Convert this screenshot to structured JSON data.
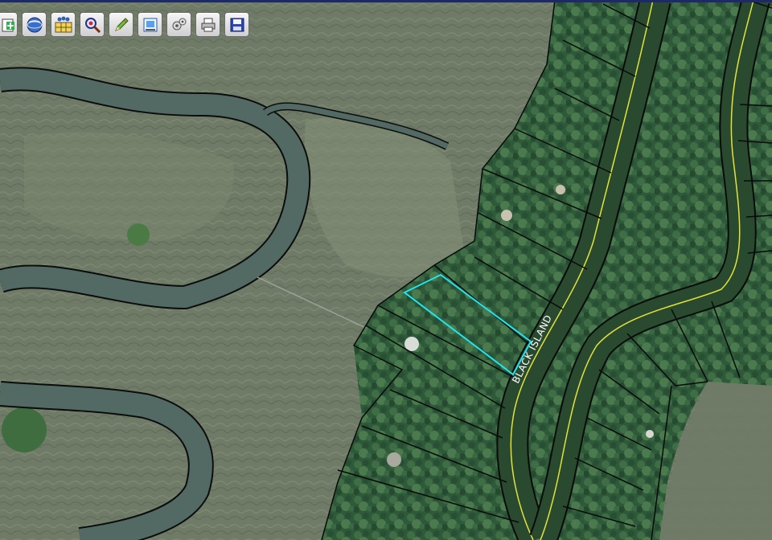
{
  "map": {
    "street_label": "BLACK ISLAND",
    "colors": {
      "marsh": "#6f7b67",
      "marsh_light": "#838f76",
      "water": "#536a64",
      "forest": "#2f5a3a",
      "forest_light": "#4c7a4e",
      "parcel_line": "#0a0a0a",
      "road_centerline": "#e2e23a",
      "selected_parcel": "#22e4f0",
      "window_border": "#1e2a66"
    }
  },
  "toolbar": {
    "buttons": [
      {
        "name": "add-icon"
      },
      {
        "name": "globe-icon"
      },
      {
        "name": "table-icon"
      },
      {
        "name": "identify-icon"
      },
      {
        "name": "pencil-icon"
      },
      {
        "name": "measure-icon"
      },
      {
        "name": "settings-icon"
      },
      {
        "name": "print-icon"
      },
      {
        "name": "save-icon"
      }
    ]
  }
}
